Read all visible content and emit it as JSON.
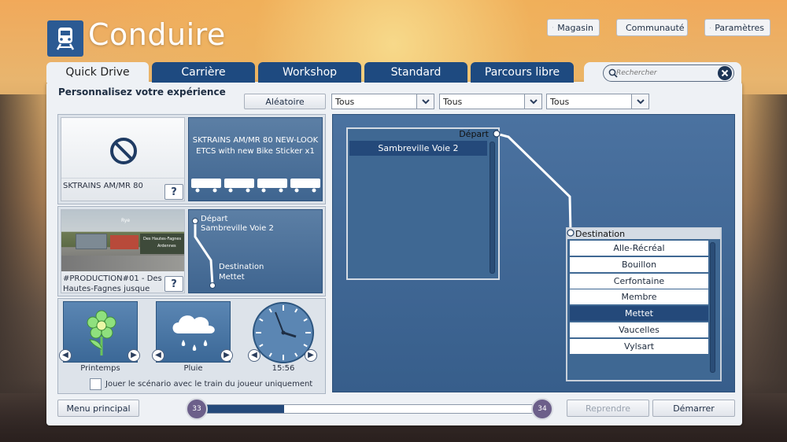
{
  "app": {
    "title": "Conduire",
    "logo_icon": "train-icon"
  },
  "header_buttons": [
    {
      "label": "Magasin",
      "icon": "cart-icon"
    },
    {
      "label": "Communauté",
      "icon": "globe-icon"
    },
    {
      "label": "Paramètres",
      "icon": "gear-icon"
    }
  ],
  "tabs": [
    {
      "label": "Quick Drive",
      "active": true
    },
    {
      "label": "Carrière",
      "active": false
    },
    {
      "label": "Workshop",
      "active": false
    },
    {
      "label": "Standard",
      "active": false
    },
    {
      "label": "Parcours libre",
      "active": false
    }
  ],
  "search": {
    "placeholder": "Rechercher"
  },
  "headline": "Personnalisez votre expérience",
  "filters": {
    "random_label": "Aléatoire",
    "dropdowns": [
      "Tous",
      "Tous",
      "Tous"
    ]
  },
  "train": {
    "name": "SKTRAINS AM/MR 80",
    "help": "?",
    "consist_line1": "SKTRAINS AM/MR 80 NEW-LOOK",
    "consist_line2": "ETCS with new Bike Sticker x1"
  },
  "route": {
    "name_line1": "#PRODUCTION#01 - Des",
    "name_line2": "Hautes-Fagnes jusque",
    "help": "?",
    "thumb_sign": "Des Hautes-Fagnes",
    "thumb_sign2": "Ardennes",
    "thumb_rye": "Rye",
    "start_label": "Départ",
    "start_value": "Sambreville Voie 2",
    "dest_label": "Destination",
    "dest_value": "Mettet"
  },
  "conditions": {
    "season": "Printemps",
    "weather": "Pluie",
    "time": "15:56",
    "checkbox_label": "Jouer le scénario avec le train du joueur uniquement",
    "checkbox_checked": false
  },
  "route_panel": {
    "depart_label": "Départ",
    "depart_items": [
      "Sambreville Voie 2"
    ],
    "depart_selected": 0,
    "dest_label": "Destination",
    "dest_items": [
      "Alle-Récréal",
      "Bouillon",
      "Cerfontaine",
      "Membre",
      "Mettet",
      "Vaucelles",
      "Vylsart"
    ],
    "dest_selected": 4
  },
  "footer": {
    "main_menu": "Menu principal",
    "resume": "Reprendre",
    "start": "Démarrer",
    "progress_left": "33",
    "progress_right": "34",
    "progress_fraction": 0.24
  },
  "colors": {
    "tab_blue": "#1e4a80",
    "panel_blue": "#4b72a0",
    "selected_row": "#24497a"
  }
}
